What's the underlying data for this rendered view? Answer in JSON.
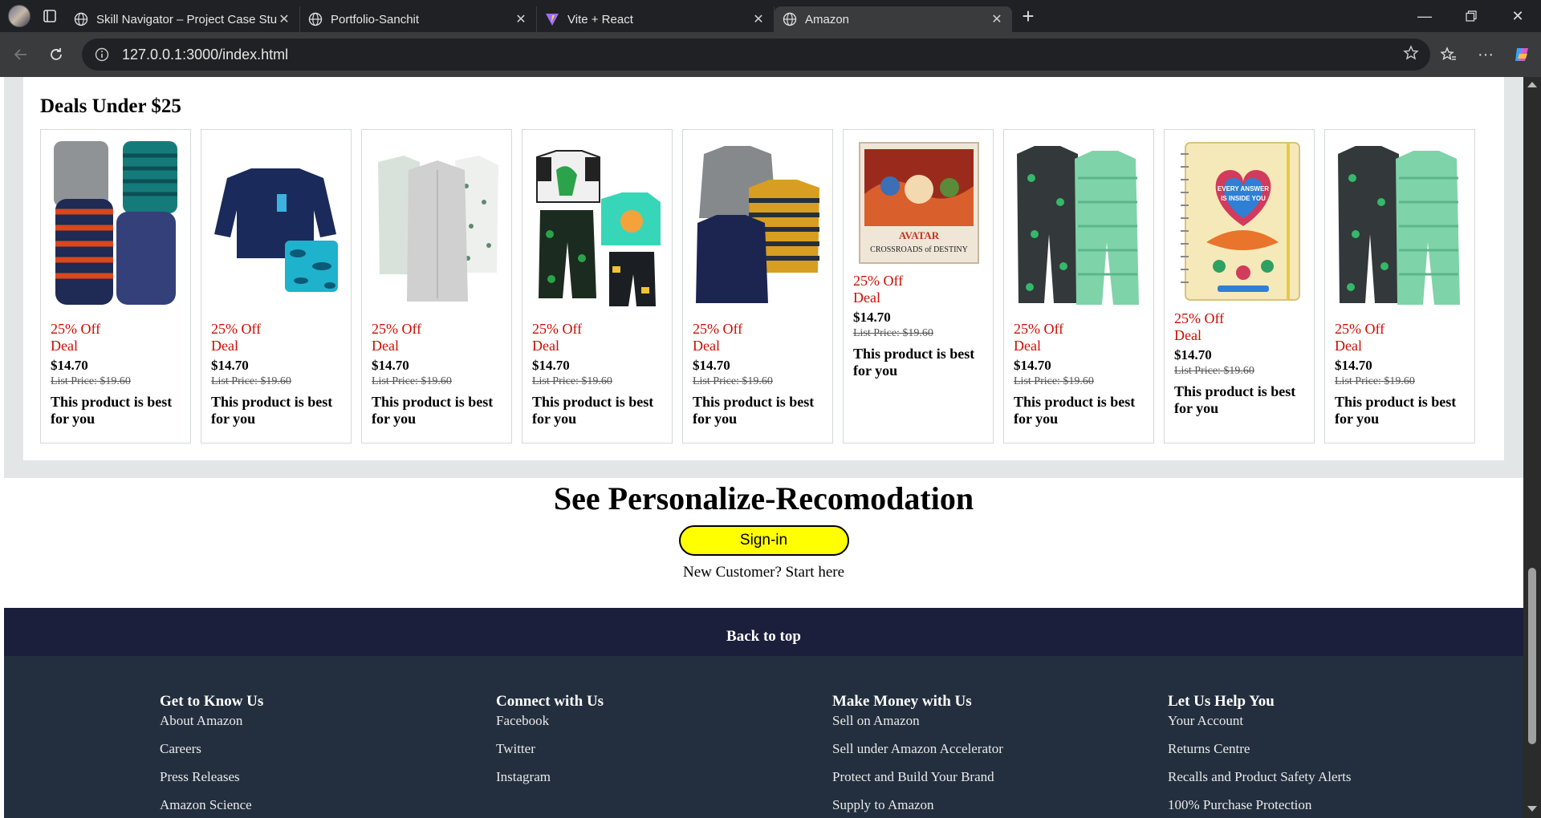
{
  "browser": {
    "tabs": [
      {
        "title": "Skill Navigator – Project Case Stud",
        "active": false
      },
      {
        "title": "Portfolio-Sanchit",
        "active": false
      },
      {
        "title": "Vite + React",
        "active": false
      },
      {
        "title": "Amazon",
        "active": true
      }
    ],
    "url": "127.0.0.1:3000/index.html"
  },
  "deals": {
    "title": "Deals Under $25",
    "products": [
      {
        "image": "baby-bodysuits-set",
        "discount": "25% Off",
        "deal": "Deal",
        "price": "$14.70",
        "list_price": "List Price: $19.60",
        "description": "This product is best for you"
      },
      {
        "image": "navy-shirt-and-swim-shorts",
        "discount": "25% Off",
        "deal": "Deal",
        "price": "$14.70",
        "list_price": "List Price: $19.60",
        "description": "This product is best for you"
      },
      {
        "image": "white-sleeper-gowns",
        "discount": "25% Off",
        "deal": "Deal",
        "price": "$14.70",
        "list_price": "List Price: $19.60",
        "description": "This product is best for you"
      },
      {
        "image": "dinosaur-pajama-set",
        "discount": "25% Off",
        "deal": "Deal",
        "price": "$14.70",
        "list_price": "List Price: $19.60",
        "description": "This product is best for you"
      },
      {
        "image": "striped-sweaters-set",
        "discount": "25% Off",
        "deal": "Deal",
        "price": "$14.70",
        "list_price": "List Price: $19.60",
        "description": "This product is best for you"
      },
      {
        "image": "avatar-board-game",
        "discount": "25% Off",
        "deal": "Deal",
        "price": "$14.70",
        "list_price": "List Price: $19.60",
        "description": "This product is best for you",
        "image_text": "AVATAR CROSSROADS of DESTINY"
      },
      {
        "image": "dinosaur-footed-sleepers",
        "discount": "25% Off",
        "deal": "Deal",
        "price": "$14.70",
        "list_price": "List Price: $19.60",
        "description": "This product is best for you"
      },
      {
        "image": "weekly-planner",
        "discount": "25% Off",
        "deal": "Deal",
        "price": "$14.70",
        "list_price": "List Price: $19.60",
        "description": "This product is best for you",
        "image_text": "EVERY ANSWER IS INSIDE YOU"
      },
      {
        "image": "dinosaur-footed-sleepers",
        "discount": "25% Off",
        "deal": "Deal",
        "price": "$14.70",
        "list_price": "List Price: $19.60",
        "description": "This product is best for you"
      }
    ]
  },
  "personalize": {
    "heading": "See Personalize-Recomodation",
    "signin_label": "Sign-in",
    "new_customer": "New Customer? Start here"
  },
  "back_to_top": "Back to top",
  "footer": {
    "columns": [
      {
        "heading": "Get to Know Us",
        "links": [
          "About Amazon",
          "Careers",
          "Press Releases",
          "Amazon Science"
        ]
      },
      {
        "heading": "Connect with Us",
        "links": [
          "Facebook",
          "Twitter",
          "Instagram"
        ]
      },
      {
        "heading": "Make Money with Us",
        "links": [
          "Sell on Amazon",
          "Sell under Amazon Accelerator",
          "Protect and Build Your Brand",
          "Supply to Amazon"
        ]
      },
      {
        "heading": "Let Us Help You",
        "links": [
          "Your Account",
          "Returns Centre",
          "Recalls and Product Safety Alerts",
          "100% Purchase Protection"
        ]
      }
    ]
  },
  "colors": {
    "deal_red": "#cc0c00",
    "signin_yellow": "#ffff00",
    "back_to_top_bg": "#1b1f3b",
    "footer_bg": "#232f3e"
  }
}
